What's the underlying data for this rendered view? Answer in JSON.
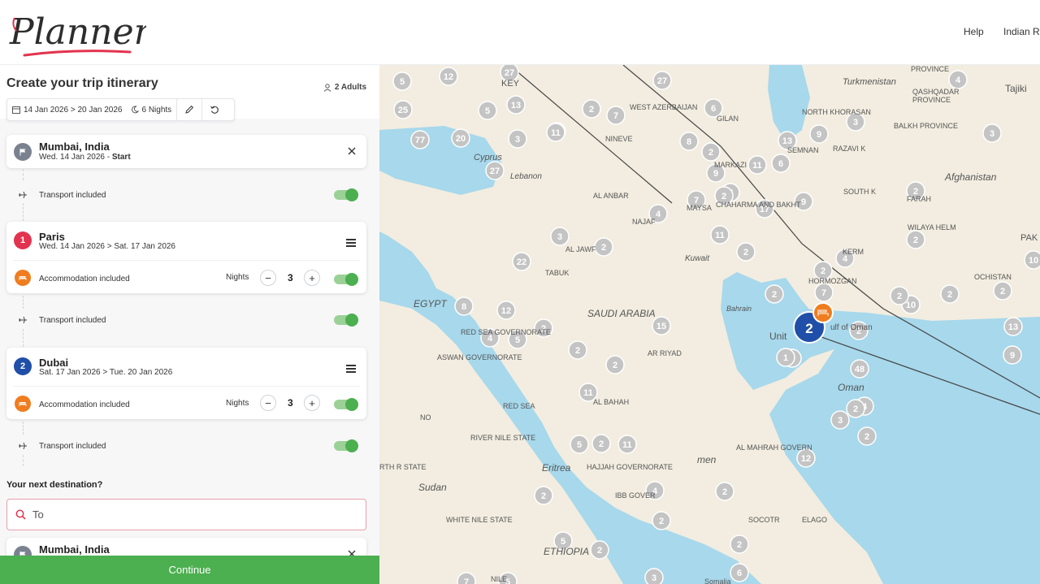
{
  "header": {
    "logo_text": "Planner",
    "nav": {
      "help": "Help",
      "currency": "Indian R"
    }
  },
  "panel": {
    "title": "Create your trip itinerary",
    "adults": "2 Adults",
    "date_range": "14 Jan 2026 > 20 Jan 2026",
    "nights": "6 Nights",
    "start": {
      "name": "Mumbai, India",
      "date": "Wed. 14 Jan 2026 - ",
      "date_tag": "Start"
    },
    "transport_1": "Transport included",
    "stops": [
      {
        "number": "1",
        "name": "Paris",
        "dates": "Wed. 14 Jan 2026 > Sat. 17 Jan 2026",
        "accommodation": "Accommodation included",
        "nights_label": "Nights",
        "nights": "3",
        "color": "#e2334f"
      },
      {
        "number": "2",
        "name": "Dubai",
        "dates": "Sat. 17 Jan 2026 > Tue. 20 Jan 2026",
        "accommodation": "Accommodation included",
        "nights_label": "Nights",
        "nights": "3",
        "color": "#1f4fa8"
      }
    ],
    "transport_2": "Transport included",
    "transport_3": "Transport included",
    "next_destination_label": "Your next destination?",
    "search_placeholder": "To",
    "end": {
      "name": "Mumbai, India"
    },
    "continue_label": "Continue"
  },
  "map": {
    "labels": [
      {
        "text": "Turkmenistan"
      },
      {
        "text": "PROVINCE"
      },
      {
        "text": "QASHQADAR"
      },
      {
        "text": "PROVINCE"
      },
      {
        "text": "Tajiki"
      },
      {
        "text": "KEY"
      },
      {
        "text": "WEST AZERBAIJAN"
      },
      {
        "text": "GILAN"
      },
      {
        "text": "NORTH KHORASAN"
      },
      {
        "text": "BALKH PROVINCE"
      },
      {
        "text": "NINEVE"
      },
      {
        "text": "SEMNAN"
      },
      {
        "text": "RAZAVI K"
      },
      {
        "text": "Cyprus"
      },
      {
        "text": "Lebanon"
      },
      {
        "text": "MARKAZI"
      },
      {
        "text": "Afghanistan"
      },
      {
        "text": "AL ANBAR"
      },
      {
        "text": "CHAHARMA AND BAKHT"
      },
      {
        "text": "SOUTH K"
      },
      {
        "text": "FARAH"
      },
      {
        "text": "MAYSA"
      },
      {
        "text": "NAJAF"
      },
      {
        "text": "WILAYA HELM"
      },
      {
        "text": "AL JAWF"
      },
      {
        "text": "Kuwait"
      },
      {
        "text": "TABUK"
      },
      {
        "text": "KERM"
      },
      {
        "text": "PAK"
      },
      {
        "text": "HORMOZGAN"
      },
      {
        "text": "OCHISTAN"
      },
      {
        "text": "EGYPT"
      },
      {
        "text": "SAUDI ARABIA"
      },
      {
        "text": "Bahrain"
      },
      {
        "text": "RED SEA GOVERNORATE"
      },
      {
        "text": "AR RIYAD"
      },
      {
        "text": "ASWAN GOVERNORATE"
      },
      {
        "text": "Oman"
      },
      {
        "text": "AL BAHAH"
      },
      {
        "text": "RED SEA"
      },
      {
        "text": "RIVER NILE STATE"
      },
      {
        "text": "AL MAHRAH GOVERN"
      },
      {
        "text": "RTH R STATE"
      },
      {
        "text": "Eritrea"
      },
      {
        "text": "HAJJAH GOVERNORATE"
      },
      {
        "text": "men"
      },
      {
        "text": "Sudan"
      },
      {
        "text": "IBB GOVER"
      },
      {
        "text": "WHITE NILE STATE"
      },
      {
        "text": "SOCOTR"
      },
      {
        "text": "ELAGO"
      },
      {
        "text": "ETHIOPIA"
      },
      {
        "text": "Somalia"
      },
      {
        "text": "NILE"
      },
      {
        "text": "ulf of Oman"
      },
      {
        "text": "Unit"
      },
      {
        "text": "NO"
      }
    ],
    "clusters": [
      "5",
      "12",
      "27",
      "25",
      "5",
      "13",
      "11",
      "2",
      "7",
      "27",
      "77",
      "20",
      "3",
      "2",
      "27",
      "6",
      "13",
      "9",
      "3",
      "11",
      "8",
      "9",
      "11",
      "6",
      "4",
      "3",
      "7",
      "7",
      "17",
      "9",
      "2",
      "4",
      "11",
      "2",
      "2",
      "3",
      "22",
      "2",
      "2",
      "7",
      "4",
      "10",
      "2",
      "2",
      "13",
      "2",
      "9",
      "2",
      "9",
      "8",
      "12",
      "2",
      "2",
      "15",
      "4",
      "5",
      "2",
      "11",
      "48",
      "4",
      "3",
      "11",
      "12",
      "2",
      "4",
      "2",
      "2",
      "5",
      "2",
      "3",
      "2",
      "7",
      "5",
      "5",
      "2",
      "2",
      "10",
      "2",
      "2",
      "1",
      "6",
      "2"
    ],
    "selected_cluster": "2",
    "colors": {
      "water": "#a7d8ec",
      "land": "#f2ede0",
      "cluster": "#c4c4c4",
      "route": "#444444",
      "hotel": "#ef7d1f",
      "selected": "#1f4fa8"
    }
  }
}
